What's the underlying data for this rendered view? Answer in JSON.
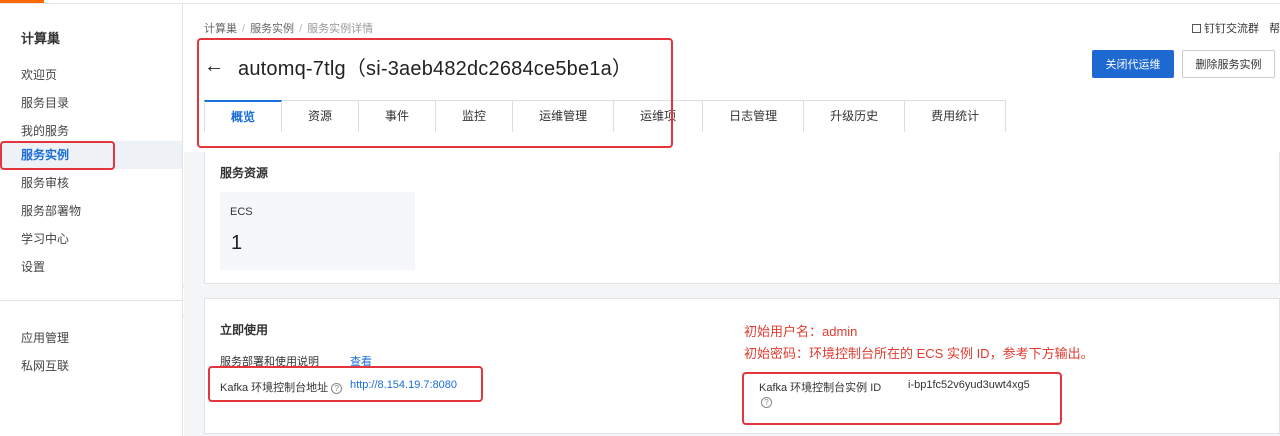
{
  "sidebar": {
    "title": "计算巢",
    "items": [
      {
        "label": "欢迎页"
      },
      {
        "label": "服务目录"
      },
      {
        "label": "我的服务"
      },
      {
        "label": "服务实例"
      },
      {
        "label": "服务审核"
      },
      {
        "label": "服务部署物"
      },
      {
        "label": "学习中心"
      },
      {
        "label": "设置"
      }
    ],
    "secondary_items": [
      {
        "label": "应用管理"
      },
      {
        "label": "私网互联"
      }
    ],
    "active_index": 3,
    "collapse_icon": "chevron-left-icon"
  },
  "breadcrumb": [
    "计算巢",
    "服务实例",
    "服务实例详情"
  ],
  "top_links": {
    "dingtalk": "钉钉交流群",
    "help": "帮"
  },
  "header": {
    "title": "automq-7tlg（si-3aeb482dc2684ce5be1a）",
    "back_icon": "arrow-left-icon",
    "primary_button": "关闭代运维",
    "secondary_button": "删除服务实例"
  },
  "tabs": [
    {
      "label": "概览",
      "active": true
    },
    {
      "label": "资源"
    },
    {
      "label": "事件"
    },
    {
      "label": "监控"
    },
    {
      "label": "运维管理"
    },
    {
      "label": "运维项"
    },
    {
      "label": "日志管理"
    },
    {
      "label": "升级历史"
    },
    {
      "label": "费用统计"
    }
  ],
  "resources": {
    "title": "服务资源",
    "ecs_label": "ECS",
    "ecs_count": "1"
  },
  "usage": {
    "title": "立即使用",
    "doc_label": "服务部署和使用说明",
    "doc_link": "查看",
    "kafka_console_label": "Kafka 环境控制台地址",
    "kafka_console_url": "http://8.154.19.7:8080",
    "kafka_instance_label": "Kafka 环境控制台实例 ID",
    "kafka_instance_id": "i-bp1fc52v6yud3uwt4xg5"
  },
  "annotations": {
    "line1": "初始用户名：admin",
    "line2": "初始密码：环境控制台所在的 ECS 实例 ID，参考下方输出。",
    "color": "#e03c31"
  },
  "colors": {
    "accent": "#1a6fd8",
    "primary_button": "#1e68d2",
    "brand": "#ff6a00",
    "highlight": "#e5353c"
  }
}
